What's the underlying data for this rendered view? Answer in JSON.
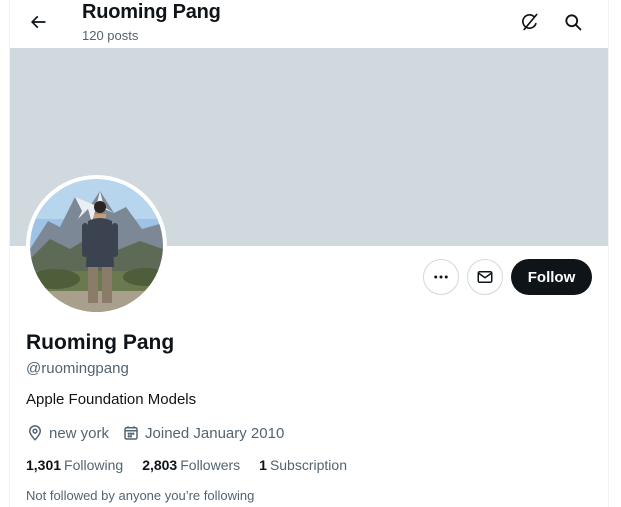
{
  "header": {
    "title": "Ruoming Pang",
    "post_count": "120 posts",
    "icons": [
      "back-arrow-icon",
      "grok-icon",
      "search-icon"
    ]
  },
  "profile": {
    "name": "Ruoming Pang",
    "handle": "@ruomingpang",
    "bio": "Apple Foundation Models",
    "location": "new york",
    "joined": "Joined January 2010",
    "follow_label": "Follow",
    "followed_by": "Not followed by anyone you’re following"
  },
  "stats": {
    "following_count": "1,301",
    "following_label": "Following",
    "followers_count": "2,803",
    "followers_label": "Followers",
    "subscription_count": "1",
    "subscription_label": "Subscription"
  },
  "colors": {
    "banner": "#cfd9de",
    "follow_button": "#0f1419",
    "secondary_text": "#536471"
  }
}
